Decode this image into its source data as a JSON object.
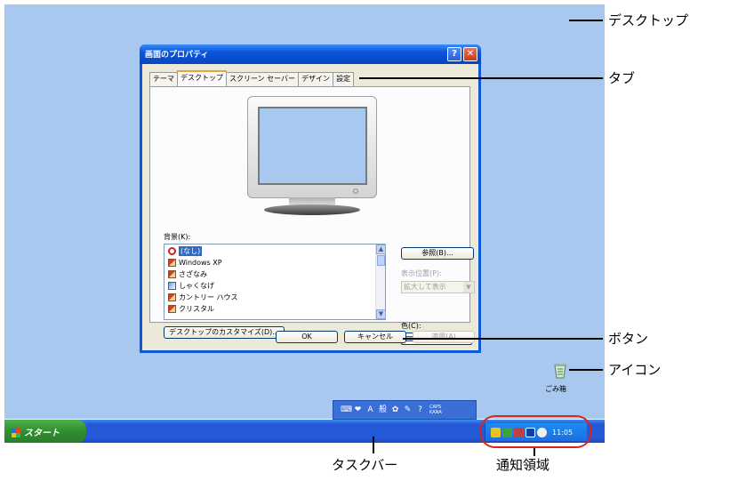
{
  "dialog": {
    "title": "画面のプロパティ",
    "help_label": "?",
    "close_label": "✕",
    "tabs": [
      "テーマ",
      "デスクトップ",
      "スクリーン セーバー",
      "デザイン",
      "設定"
    ],
    "background_label": "背景(K):",
    "backgrounds": [
      "(なし)",
      "Windows XP",
      "さざなみ",
      "しゃくなげ",
      "カントリー ハウス",
      "クリスタル"
    ],
    "browse_button": "参照(B)...",
    "position_label": "表示位置(P):",
    "position_value": "拡大して表示",
    "color_label": "色(C):",
    "color_value": "#a8c8f0",
    "customize_button": "デスクトップのカスタマイズ(D)...",
    "ok_button": "OK",
    "cancel_button": "キャンセル",
    "apply_button": "適用(A)"
  },
  "desktop": {
    "background_color": "#a8c8f0",
    "recycle_bin_label": "ごみ箱"
  },
  "language_bar": {
    "ime_mode": "A",
    "ime_label": "般",
    "caps": "CAPS",
    "kana": "KANA"
  },
  "taskbar": {
    "start_label": "スタート",
    "clock": "11:05"
  },
  "callouts": {
    "desktop": "デスクトップ",
    "tab": "タブ",
    "button": "ボタン",
    "icon": "アイコン",
    "taskbar": "タスクバー",
    "notification_area": "通知領域"
  }
}
